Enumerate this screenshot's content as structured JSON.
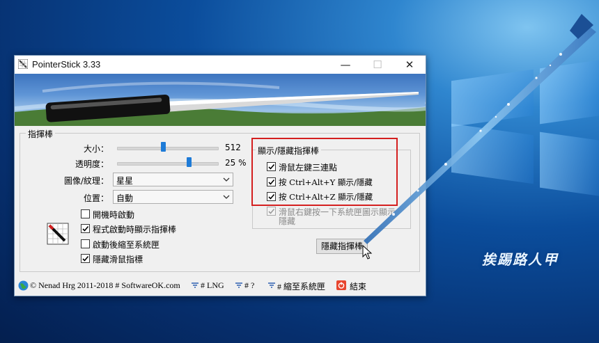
{
  "window": {
    "title": "PointerStick 3.33",
    "minimize_glyph": "—",
    "maximize_glyph": "☐",
    "close_glyph": "✕"
  },
  "pointer_group": {
    "legend": "指揮棒",
    "size_label": "大小：",
    "size_value": "512",
    "size_fraction": 0.45,
    "opacity_label": "透明度：",
    "opacity_value": "25 %",
    "opacity_fraction": 0.72,
    "image_label": "圖像/紋理：",
    "image_value": "星星",
    "position_label": "位置：",
    "position_value": "自動",
    "checkboxes": [
      {
        "label": "開機時啟動",
        "checked": false
      },
      {
        "label": "程式啟動時顯示指揮棒",
        "checked": true
      },
      {
        "label": "啟動後縮至系統匣",
        "checked": false
      },
      {
        "label": "隱藏滑鼠指標",
        "checked": true
      }
    ]
  },
  "toggle_group": {
    "legend": "顯示/隱藏指揮棒",
    "checkboxes": [
      {
        "label": "滑鼠左鍵三連點",
        "checked": true
      },
      {
        "label": "按 Ctrl+Alt+Y 顯示/隱藏",
        "checked": true
      },
      {
        "label": "按 Ctrl+Alt+Z 顯示/隱藏",
        "checked": true
      }
    ],
    "disabled_option_line1": "滑鼠右鍵按一下系統匣圖示顯示",
    "disabled_option_line2": "隱藏",
    "disabled_option_checked": true,
    "hide_button": "隱藏指揮棒"
  },
  "footer": {
    "copyright": "© Nenad Hrg 2011-2018 # SoftwareOK.com",
    "lng": "# LNG",
    "help": "# ?",
    "tray": "# 縮至系統匣",
    "exit": "結束"
  },
  "watermark": "挨踢路人甲",
  "colors": {
    "accent": "#1e7bd7",
    "highlight_frame": "#d41f1f",
    "exit_icon": "#e8452e"
  }
}
